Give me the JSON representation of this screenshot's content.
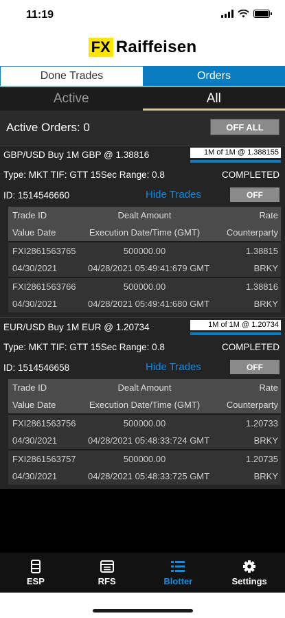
{
  "status": {
    "time": "11:19"
  },
  "brand": {
    "fx": "FX",
    "name": "Raiffeisen"
  },
  "segments": {
    "done_trades": "Done Trades",
    "orders": "Orders"
  },
  "filter": {
    "active": "Active",
    "all": "All"
  },
  "active_orders": {
    "label": "Active Orders: 0",
    "off_all": "OFF ALL"
  },
  "orders": [
    {
      "title": "GBP/USD Buy 1M GBP @ 1.38816",
      "fill_text": "1M of 1M @ 1.388155",
      "fill_fraction": 1.0,
      "details": "Type: MKT TIF: GTT 15Sec Range: 0.8",
      "status": "COMPLETED",
      "id": "ID: 1514546660",
      "hide_trades": "Hide Trades",
      "toggle": "OFF",
      "trades": [
        {
          "trade_id": "FXI2861563765",
          "amount": "500000.00",
          "rate": "1.38815",
          "value_date": "04/30/2021",
          "exec_time": "04/28/2021 05:49:41:679 GMT",
          "counterparty": "BRKY"
        },
        {
          "trade_id": "FXI2861563766",
          "amount": "500000.00",
          "rate": "1.38816",
          "value_date": "04/30/2021",
          "exec_time": "04/28/2021 05:49:41:680 GMT",
          "counterparty": "BRKY"
        }
      ]
    },
    {
      "title": "EUR/USD Buy 1M EUR @ 1.20734",
      "fill_text": "1M of 1M @ 1.20734",
      "fill_fraction": 1.0,
      "details": "Type: MKT TIF: GTT 15Sec Range: 0.8",
      "status": "COMPLETED",
      "id": "ID: 1514546658",
      "hide_trades": "Hide Trades",
      "toggle": "OFF",
      "trades": [
        {
          "trade_id": "FXI2861563756",
          "amount": "500000.00",
          "rate": "1.20733",
          "value_date": "04/30/2021",
          "exec_time": "04/28/2021 05:48:33:724 GMT",
          "counterparty": "BRKY"
        },
        {
          "trade_id": "FXI2861563757",
          "amount": "500000.00",
          "rate": "1.20735",
          "value_date": "04/30/2021",
          "exec_time": "04/28/2021 05:48:33:725 GMT",
          "counterparty": "BRKY"
        }
      ]
    }
  ],
  "trade_headers": {
    "trade_id": "Trade ID",
    "dealt_amount": "Dealt Amount",
    "rate": "Rate",
    "value_date": "Value Date",
    "exec_time": "Execution Date/Time (GMT)",
    "counterparty": "Counterparty"
  },
  "tabs": [
    {
      "label": "ESP",
      "icon": "esp-icon"
    },
    {
      "label": "RFS",
      "icon": "rfs-icon"
    },
    {
      "label": "Blotter",
      "icon": "blotter-list-icon"
    },
    {
      "label": "Settings",
      "icon": "gear-icon"
    }
  ],
  "colors": {
    "accent": "#0a7dc2",
    "brand_yellow": "#ffe600",
    "link": "#0a8ee6"
  }
}
